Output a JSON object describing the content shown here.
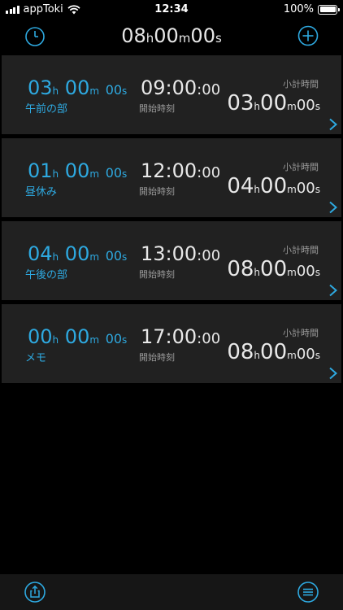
{
  "status": {
    "carrier": "appToki",
    "time": "12:34",
    "battery": "100%",
    "battery_level": 1.0
  },
  "nav": {
    "total": {
      "h": "08",
      "h_unit": "h",
      "m": "00",
      "m_unit": "m",
      "s": "00",
      "s_unit": "s"
    },
    "left_icon": "stopwatch-icon",
    "right_icon": "add-icon"
  },
  "accent_color": "#2ea9e0",
  "cards": [
    {
      "dur_h": "03",
      "dur_m": "00",
      "dur_s": "00",
      "label": "午前の部",
      "start_hm": "09:00",
      "start_s": ":00",
      "start_caption": "開始時刻",
      "sub_caption": "小計時間",
      "sub_h": "03",
      "sub_m": "00",
      "sub_s": "00"
    },
    {
      "dur_h": "01",
      "dur_m": "00",
      "dur_s": "00",
      "label": "昼休み",
      "start_hm": "12:00",
      "start_s": ":00",
      "start_caption": "開始時刻",
      "sub_caption": "小計時間",
      "sub_h": "04",
      "sub_m": "00",
      "sub_s": "00"
    },
    {
      "dur_h": "04",
      "dur_m": "00",
      "dur_s": "00",
      "label": "午後の部",
      "start_hm": "13:00",
      "start_s": ":00",
      "start_caption": "開始時刻",
      "sub_caption": "小計時間",
      "sub_h": "08",
      "sub_m": "00",
      "sub_s": "00"
    },
    {
      "dur_h": "00",
      "dur_m": "00",
      "dur_s": "00",
      "label": "メモ",
      "start_hm": "17:00",
      "start_s": ":00",
      "start_caption": "開始時刻",
      "sub_caption": "小計時間",
      "sub_h": "08",
      "sub_m": "00",
      "sub_s": "00"
    }
  ],
  "units": {
    "h": "h",
    "m": "m",
    "s": "s"
  },
  "toolbar": {
    "left_icon": "share-icon",
    "right_icon": "menu-icon"
  }
}
